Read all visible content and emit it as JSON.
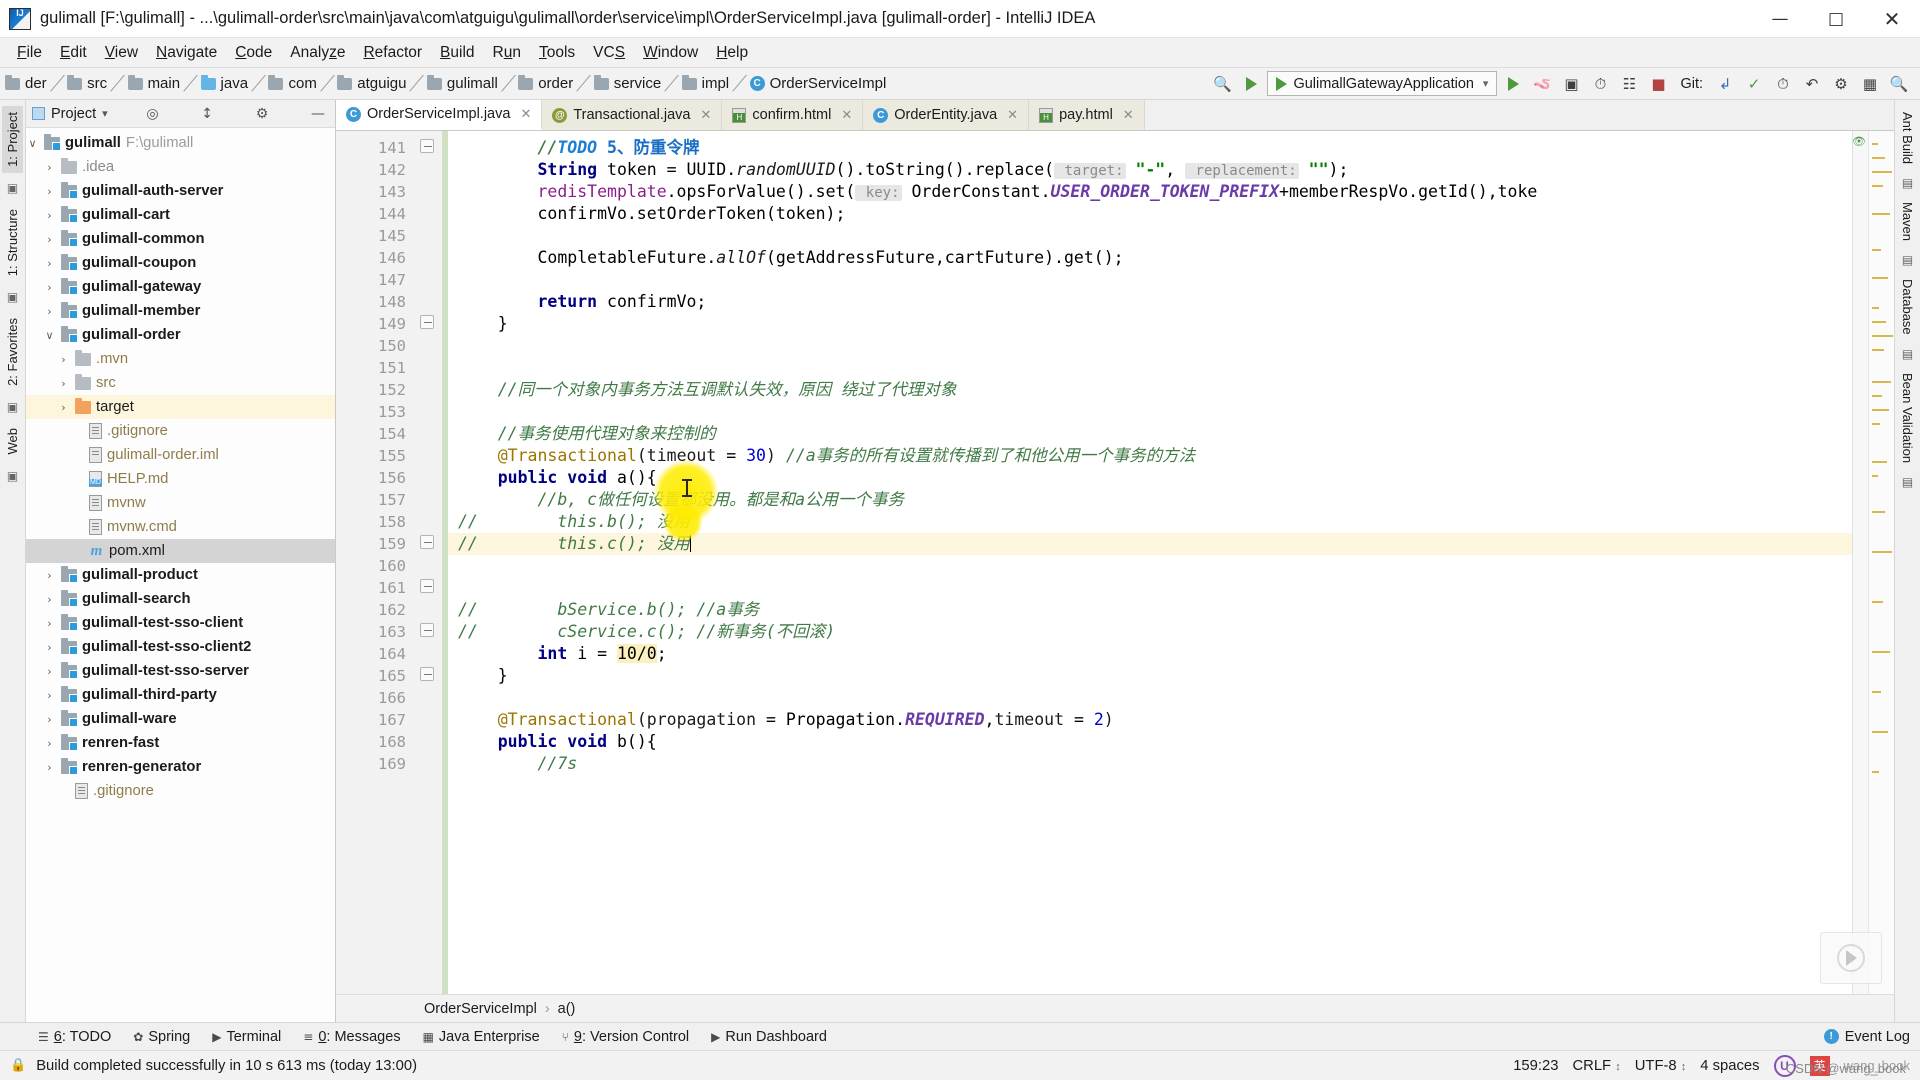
{
  "window": {
    "title": "gulimall [F:\\gulimall] - ...\\gulimall-order\\src\\main\\java\\com\\atguigu\\gulimall\\order\\service\\impl\\OrderServiceImpl.java [gulimall-order] - IntelliJ IDEA",
    "minimize": "—",
    "maximize": "□",
    "close": "✕"
  },
  "menu": [
    {
      "label": "File",
      "mnemonic": "F"
    },
    {
      "label": "Edit",
      "mnemonic": "E"
    },
    {
      "label": "View",
      "mnemonic": "V"
    },
    {
      "label": "Navigate",
      "mnemonic": "N"
    },
    {
      "label": "Code",
      "mnemonic": "C"
    },
    {
      "label": "Analyze",
      "mnemonic": "z"
    },
    {
      "label": "Refactor",
      "mnemonic": "R"
    },
    {
      "label": "Build",
      "mnemonic": "B"
    },
    {
      "label": "Run",
      "mnemonic": "u"
    },
    {
      "label": "Tools",
      "mnemonic": "T"
    },
    {
      "label": "VCS",
      "mnemonic": "S"
    },
    {
      "label": "Window",
      "mnemonic": "W"
    },
    {
      "label": "Help",
      "mnemonic": "H"
    }
  ],
  "navbar": {
    "crumbs": [
      {
        "label": "der",
        "icon": "folder-icon"
      },
      {
        "label": "src",
        "icon": "folder-icon"
      },
      {
        "label": "main",
        "icon": "folder-icon"
      },
      {
        "label": "java",
        "icon": "folder-icon-blue"
      },
      {
        "label": "com",
        "icon": "folder-icon"
      },
      {
        "label": "atguigu",
        "icon": "folder-icon"
      },
      {
        "label": "gulimall",
        "icon": "folder-icon"
      },
      {
        "label": "order",
        "icon": "folder-icon"
      },
      {
        "label": "service",
        "icon": "folder-icon"
      },
      {
        "label": "impl",
        "icon": "folder-icon"
      },
      {
        "label": "OrderServiceImpl",
        "icon": "class-icon"
      }
    ],
    "run_config": "GulimallGatewayApplication",
    "git_label": "Git:"
  },
  "project_panel": {
    "title": "Project",
    "tree": [
      {
        "label": "gulimall",
        "suffix": "F:\\gulimall",
        "depth": 0,
        "arrow": "∨",
        "icon": "module-icon",
        "bold": true
      },
      {
        "label": ".idea",
        "depth": 1,
        "arrow": "›",
        "icon": "folder-plain-icon",
        "dim": true
      },
      {
        "label": "gulimall-auth-server",
        "depth": 1,
        "arrow": "›",
        "icon": "module-icon",
        "bold": true
      },
      {
        "label": "gulimall-cart",
        "depth": 1,
        "arrow": "›",
        "icon": "module-icon",
        "bold": true
      },
      {
        "label": "gulimall-common",
        "depth": 1,
        "arrow": "›",
        "icon": "module-icon",
        "bold": true
      },
      {
        "label": "gulimall-coupon",
        "depth": 1,
        "arrow": "›",
        "icon": "module-icon",
        "bold": true
      },
      {
        "label": "gulimall-gateway",
        "depth": 1,
        "arrow": "›",
        "icon": "module-icon",
        "bold": true
      },
      {
        "label": "gulimall-member",
        "depth": 1,
        "arrow": "›",
        "icon": "module-icon",
        "bold": true
      },
      {
        "label": "gulimall-order",
        "depth": 1,
        "arrow": "∨",
        "icon": "module-icon",
        "bold": true
      },
      {
        "label": ".mvn",
        "depth": 2,
        "arrow": "›",
        "icon": "folder-plain-icon",
        "tan": true
      },
      {
        "label": "src",
        "depth": 2,
        "arrow": "›",
        "icon": "folder-plain-icon",
        "tan": true
      },
      {
        "label": "target",
        "depth": 2,
        "arrow": "›",
        "icon": "folder-orange-icon",
        "selected": "yellow"
      },
      {
        "label": ".gitignore",
        "depth": 3,
        "arrow": "",
        "icon": "file-icon",
        "tan": true
      },
      {
        "label": "gulimall-order.iml",
        "depth": 3,
        "arrow": "",
        "icon": "iml-file-icon",
        "tan": true
      },
      {
        "label": "HELP.md",
        "depth": 3,
        "arrow": "",
        "icon": "markdown-file-icon",
        "tan": true
      },
      {
        "label": "mvnw",
        "depth": 3,
        "arrow": "",
        "icon": "file-icon",
        "tan": true
      },
      {
        "label": "mvnw.cmd",
        "depth": 3,
        "arrow": "",
        "icon": "file-icon",
        "tan": true
      },
      {
        "label": "pom.xml",
        "depth": 3,
        "arrow": "",
        "icon": "maven-file-icon",
        "selected": "gray"
      },
      {
        "label": "gulimall-product",
        "depth": 1,
        "arrow": "›",
        "icon": "module-icon",
        "bold": true
      },
      {
        "label": "gulimall-search",
        "depth": 1,
        "arrow": "›",
        "icon": "module-icon",
        "bold": true
      },
      {
        "label": "gulimall-test-sso-client",
        "depth": 1,
        "arrow": "›",
        "icon": "module-icon",
        "bold": true
      },
      {
        "label": "gulimall-test-sso-client2",
        "depth": 1,
        "arrow": "›",
        "icon": "module-icon",
        "bold": true
      },
      {
        "label": "gulimall-test-sso-server",
        "depth": 1,
        "arrow": "›",
        "icon": "module-icon",
        "bold": true
      },
      {
        "label": "gulimall-third-party",
        "depth": 1,
        "arrow": "›",
        "icon": "module-icon",
        "bold": true
      },
      {
        "label": "gulimall-ware",
        "depth": 1,
        "arrow": "›",
        "icon": "module-icon",
        "bold": true
      },
      {
        "label": "renren-fast",
        "depth": 1,
        "arrow": "›",
        "icon": "module-icon",
        "bold": true
      },
      {
        "label": "renren-generator",
        "depth": 1,
        "arrow": "›",
        "icon": "module-icon",
        "bold": true
      },
      {
        "label": ".gitignore",
        "depth": 2,
        "arrow": "",
        "icon": "file-icon",
        "tan": true
      }
    ]
  },
  "left_rail": [
    {
      "label": "1: Project",
      "active": true
    },
    {
      "label": "1: Structure",
      "active": false
    },
    {
      "label": "2: Favorites",
      "active": false
    },
    {
      "label": "Web",
      "active": false
    }
  ],
  "right_rail": [
    {
      "label": "Ant Build"
    },
    {
      "label": "Maven"
    },
    {
      "label": "Database"
    },
    {
      "label": "Bean Validation"
    }
  ],
  "editor_tabs": [
    {
      "label": "OrderServiceImpl.java",
      "icon": "java-class-icon",
      "active": true
    },
    {
      "label": "Transactional.java",
      "icon": "java-annotation-icon",
      "active": false
    },
    {
      "label": "confirm.html",
      "icon": "html-file-icon",
      "active": false
    },
    {
      "label": "OrderEntity.java",
      "icon": "java-class-icon",
      "active": false
    },
    {
      "label": "pay.html",
      "icon": "html-file-icon",
      "active": false
    }
  ],
  "editor": {
    "first_line": 141,
    "lines": [
      {
        "n": 141,
        "type": "todo",
        "indent": 2,
        "text": "//TODO 5、防重令牌"
      },
      {
        "n": 142,
        "type": "code",
        "indent": 2,
        "text": "String token = UUID.randomUUID().toString().replace( target: \"-\",  replacement: \"\");"
      },
      {
        "n": 143,
        "type": "code",
        "indent": 2,
        "text": "redisTemplate.opsForValue().set( key: OrderConstant.USER_ORDER_TOKEN_PREFIX+memberRespVo.getId(),toke"
      },
      {
        "n": 144,
        "type": "code",
        "indent": 2,
        "text": "confirmVo.setOrderToken(token);"
      },
      {
        "n": 145,
        "type": "blank",
        "text": ""
      },
      {
        "n": 146,
        "type": "code",
        "indent": 2,
        "text": "CompletableFuture.allOf(getAddressFuture,cartFuture).get();"
      },
      {
        "n": 147,
        "type": "blank",
        "text": ""
      },
      {
        "n": 148,
        "type": "code",
        "indent": 2,
        "text": "return confirmVo;"
      },
      {
        "n": 149,
        "type": "code",
        "indent": 1,
        "text": "}"
      },
      {
        "n": 150,
        "type": "blank",
        "text": ""
      },
      {
        "n": 151,
        "type": "blank",
        "text": ""
      },
      {
        "n": 152,
        "type": "comment",
        "indent": 1,
        "text": "//同一个对象内事务方法互调默认失效，原因 绕过了代理对象"
      },
      {
        "n": 153,
        "type": "blank",
        "text": ""
      },
      {
        "n": 154,
        "type": "comment",
        "indent": 1,
        "text": "//事务使用代理对象来控制的"
      },
      {
        "n": 155,
        "type": "anno",
        "indent": 1,
        "text": "@Transactional(timeout = 30) //a事务的所有设置就传播到了和他公用一个事务的方法"
      },
      {
        "n": 156,
        "type": "code",
        "indent": 1,
        "text": "public void a(){"
      },
      {
        "n": 157,
        "type": "comment",
        "indent": 2,
        "text": "//b, c做任何设置都没用。都是和a公用一个事务"
      },
      {
        "n": 158,
        "type": "commented-out",
        "prefix": "//",
        "text": "this.b(); 没用"
      },
      {
        "n": 159,
        "type": "commented-out",
        "prefix": "//",
        "text": "this.c(); 没用",
        "highlighted": true,
        "cursor": true
      },
      {
        "n": 160,
        "type": "blank",
        "text": ""
      },
      {
        "n": 161,
        "type": "blank",
        "text": ""
      },
      {
        "n": 162,
        "type": "commented-out",
        "prefix": "//",
        "text": "bService.b(); //a事务"
      },
      {
        "n": 163,
        "type": "commented-out",
        "prefix": "//",
        "text": "cService.c(); //新事务(不回滚)"
      },
      {
        "n": 164,
        "type": "code",
        "indent": 2,
        "text": "int i = 10/0;"
      },
      {
        "n": 165,
        "type": "code",
        "indent": 1,
        "text": "}"
      },
      {
        "n": 166,
        "type": "blank",
        "text": ""
      },
      {
        "n": 167,
        "type": "anno",
        "indent": 1,
        "text": "@Transactional(propagation = Propagation.REQUIRED,timeout = 2)"
      },
      {
        "n": 168,
        "type": "code",
        "indent": 1,
        "text": "public void b(){"
      },
      {
        "n": 169,
        "type": "comment",
        "indent": 2,
        "text": "//7s"
      }
    ],
    "breadcrumb": {
      "class": "OrderServiceImpl",
      "sep": "›",
      "method": "a()"
    }
  },
  "toolwindows": [
    {
      "label": "6: TODO",
      "mnemonic": "6",
      "icon": "list-icon"
    },
    {
      "label": "Spring",
      "icon": "spring-icon"
    },
    {
      "label": "Terminal",
      "icon": "terminal-icon"
    },
    {
      "label": "0: Messages",
      "mnemonic": "0",
      "icon": "messages-icon"
    },
    {
      "label": "Java Enterprise",
      "icon": "java-enterprise-icon"
    },
    {
      "label": "9: Version Control",
      "mnemonic": "9",
      "icon": "branch-icon"
    },
    {
      "label": "Run Dashboard",
      "icon": "run-icon"
    }
  ],
  "event_log": {
    "label": "Event Log",
    "icon": "event-log-icon"
  },
  "statusbar": {
    "message": "Build completed successfully in 10 s 613 ms (today 13:00)",
    "caret": "159:23",
    "line_separator": "CRLF",
    "encoding": "UTF-8",
    "indent": "4 spaces",
    "ime_left": "U",
    "ime_right": "英",
    "ime_label": "wang_book",
    "watermark": "CSDN @wang_book"
  }
}
